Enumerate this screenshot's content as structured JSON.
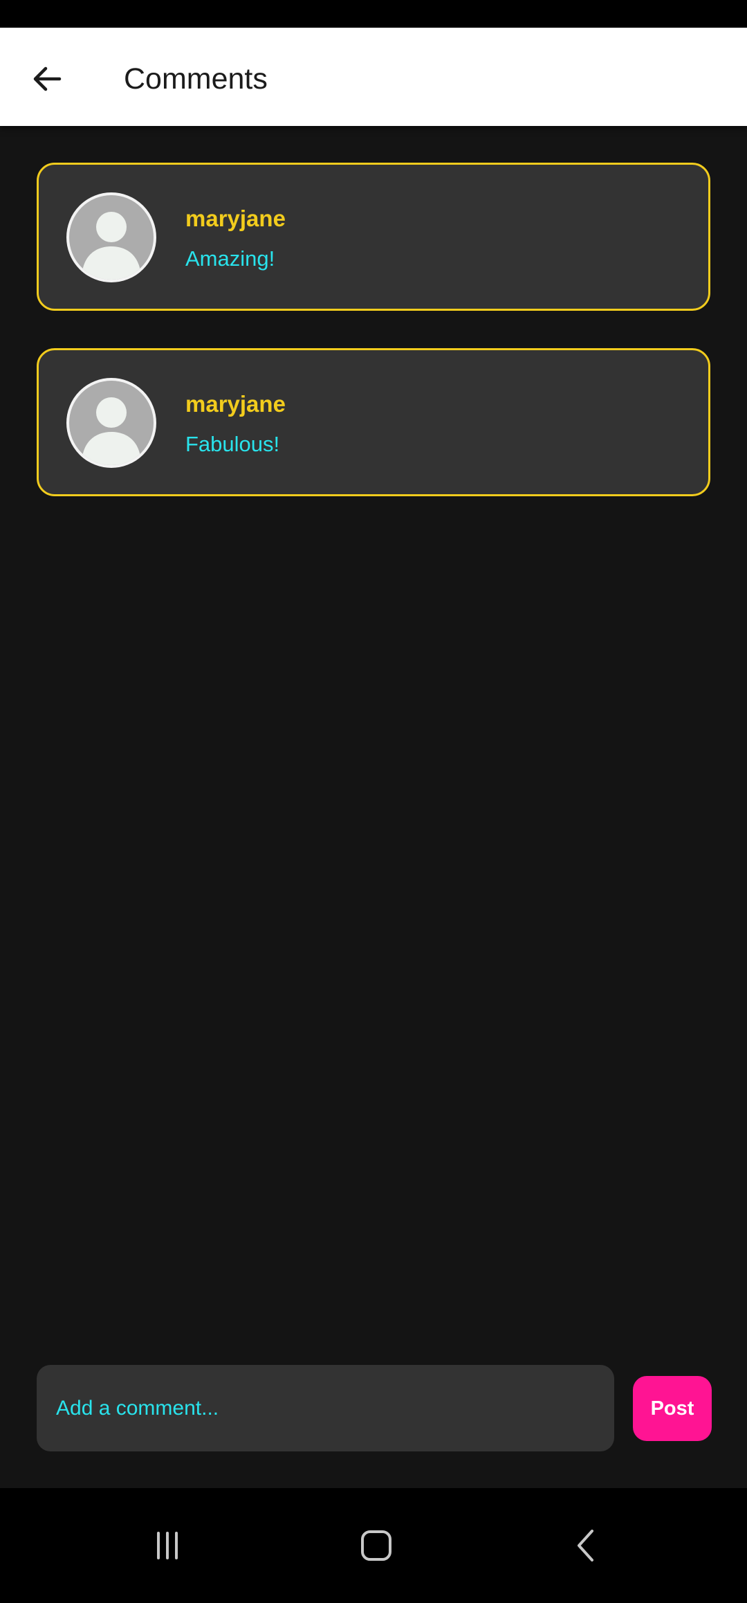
{
  "header": {
    "title": "Comments",
    "back_icon": "arrow-left-icon"
  },
  "comments": [
    {
      "author": "maryjane",
      "text": "Amazing!",
      "avatar_icon": "default-avatar-icon"
    },
    {
      "author": "maryjane",
      "text": "Fabulous!",
      "avatar_icon": "default-avatar-icon"
    }
  ],
  "composer": {
    "placeholder": "Add a comment...",
    "value": "",
    "post_label": "Post"
  },
  "navigation": {
    "recents_icon": "recents-icon",
    "home_icon": "home-icon",
    "back_icon": "nav-back-icon"
  },
  "colors": {
    "background": "#141414",
    "card": "#333333",
    "card_border": "#f2cc1d",
    "author": "#f2cc1d",
    "comment_text": "#29e3ec",
    "post_button": "#ff1493",
    "app_bar": "#ffffff"
  }
}
